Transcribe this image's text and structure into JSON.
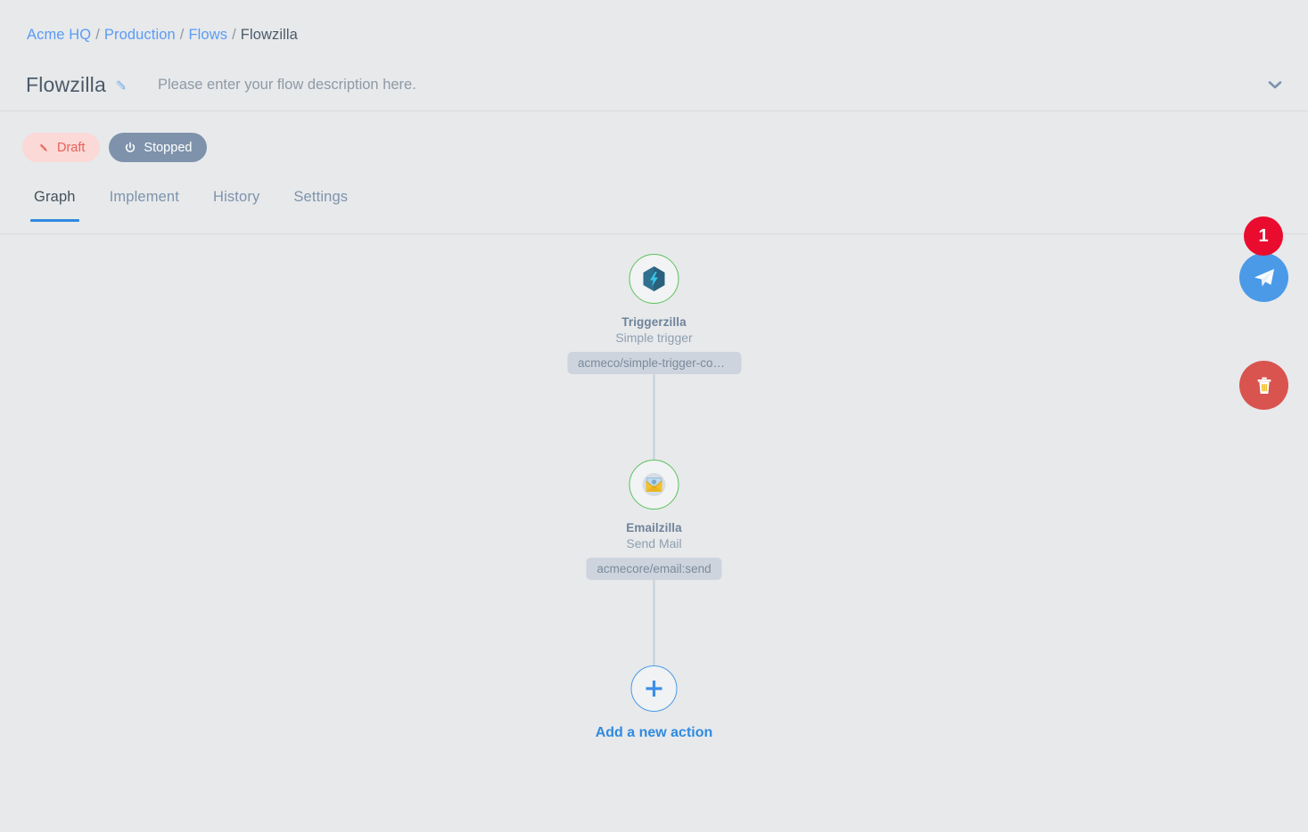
{
  "breadcrumb": {
    "items": [
      {
        "label": "Acme HQ",
        "link": true
      },
      {
        "label": "Production",
        "link": true
      },
      {
        "label": "Flows",
        "link": true
      },
      {
        "label": "Flowzilla",
        "link": false
      }
    ],
    "separator": "/"
  },
  "header": {
    "title": "Flowzilla",
    "edit_icon": "pencil-icon",
    "description_placeholder": "Please enter your flow description here.",
    "collapse_icon": "chevron-down-icon"
  },
  "status": {
    "draft": {
      "label": "Draft",
      "icon": "pencil-icon",
      "bg": "#fad9d6",
      "color": "#e8605a"
    },
    "stopped": {
      "label": "Stopped",
      "icon": "power-icon",
      "bg": "#7e93ab",
      "color": "#ffffff"
    }
  },
  "tabs": [
    {
      "label": "Graph",
      "active": true
    },
    {
      "label": "Implement",
      "active": false
    },
    {
      "label": "History",
      "active": false
    },
    {
      "label": "Settings",
      "active": false
    }
  ],
  "graph": {
    "nodes": [
      {
        "name": "Triggerzilla",
        "subtitle": "Simple trigger",
        "component": "acmeco/simple-trigger-com...",
        "icon": "hexagon-lightning-icon",
        "ring_color": "#5cc25c"
      },
      {
        "name": "Emailzilla",
        "subtitle": "Send Mail",
        "component": "acmecore/email:send",
        "icon": "envelope-icon",
        "ring_color": "#5cc25c"
      }
    ],
    "add_action": {
      "label": "Add a new action",
      "icon": "plus-icon"
    }
  },
  "actions": {
    "notification_count": "1",
    "send": {
      "icon": "paper-plane-icon",
      "color": "#4b9ae8"
    },
    "delete": {
      "icon": "trash-icon",
      "color": "#d9534f"
    }
  }
}
